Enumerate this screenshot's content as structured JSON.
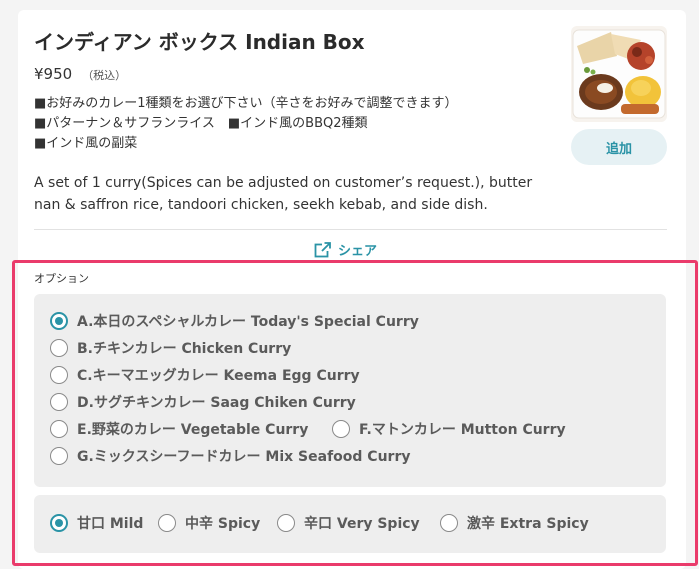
{
  "product": {
    "title": "インディアン ボックス Indian Box",
    "price": "¥950",
    "tax_note": "（税込）",
    "description_ja": [
      "■お好みのカレー1種類をお選び下さい（辛さをお好みで調整できます）",
      "■パターナン＆サフランライス　■インド風のBBQ2種類",
      "■インド風の副菜"
    ],
    "description_en": "A set of 1 curry(Spices can be adjusted on customer’s request.), butter nan & saffron rice, tandoori chicken, seekh kebab, and side dish.",
    "add_label": "追加",
    "share_label": "シェア"
  },
  "options": {
    "label": "オプション",
    "curry": [
      {
        "label": "A.本日のスペシャルカレー Today's Special Curry",
        "checked": true
      },
      {
        "label": "B.チキンカレー Chicken Curry",
        "checked": false
      },
      {
        "label": "C.キーマエッグカレー Keema Egg Curry",
        "checked": false
      },
      {
        "label": "D.サグチキンカレー Saag Chiken Curry",
        "checked": false
      },
      {
        "label": "E.野菜のカレー Vegetable Curry",
        "checked": false
      },
      {
        "label": "F.マトンカレー Mutton Curry",
        "checked": false
      },
      {
        "label": "G.ミックスシーフードカレー Mix Seafood Curry",
        "checked": false
      }
    ],
    "spice": [
      {
        "label": "甘口 Mild",
        "checked": true
      },
      {
        "label": "中辛 Spicy",
        "checked": false
      },
      {
        "label": "辛口 Very Spicy",
        "checked": false
      },
      {
        "label": "激辛 Extra Spicy",
        "checked": false
      }
    ]
  },
  "colors": {
    "accent": "#2a93a6",
    "highlight": "#ea3b6b",
    "panel": "#eeeeee"
  },
  "icons": {
    "share": "external-link-icon",
    "radio": "radio-button-icon"
  }
}
